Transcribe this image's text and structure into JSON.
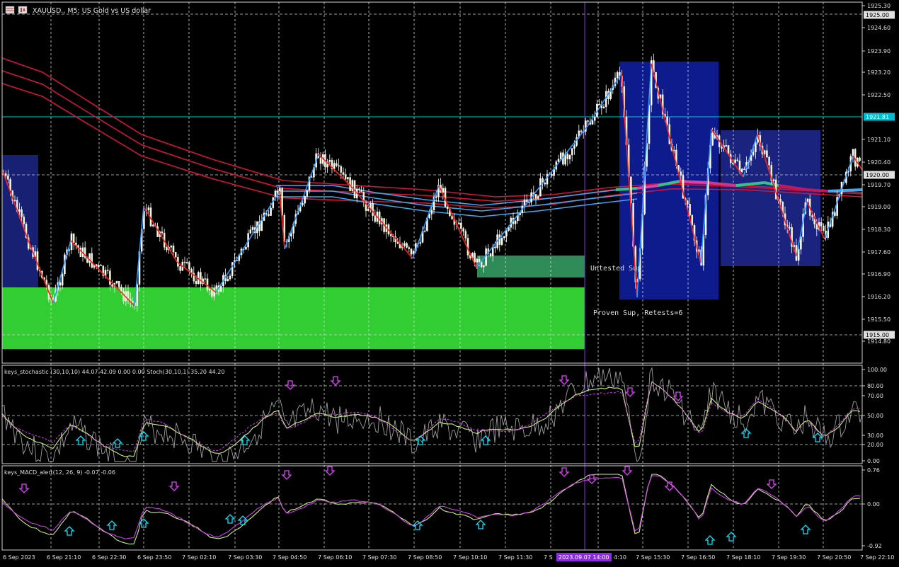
{
  "chart_header": {
    "symbol": "XAUUSD., M5: US Gold vs US dollar"
  },
  "price_axis": {
    "ticks": [
      "1925.30",
      "1924.60",
      "1923.90",
      "1923.20",
      "1922.50",
      "1921.10",
      "1920.40",
      "1919.70",
      "1919.00",
      "1918.30",
      "1917.60",
      "1916.90",
      "1916.20",
      "1915.50",
      "1914.80"
    ],
    "labels": [
      {
        "text": "1925.00",
        "kind": "level"
      },
      {
        "text": "1921.81",
        "kind": "bid"
      },
      {
        "text": "1920.00",
        "kind": "level"
      },
      {
        "text": "1915.00",
        "kind": "level"
      }
    ]
  },
  "zones": {
    "untested_label": "Untested Sup",
    "proven_label": "Proven Sup, Retests=6"
  },
  "stochastic": {
    "title": "keys_stochastic (30,10,10) 44.07 42.09 0.00 0.00 Stoch(30,10,1) 35.20 44.20",
    "ticks": [
      "100.00",
      "80.00",
      "70.00",
      "50.00",
      "30.00",
      "20.00",
      "0.00"
    ]
  },
  "macd": {
    "title": "keys_MACD_alert(12, 26, 9) -0.07 -0.06",
    "ticks": [
      "0.76",
      "0.00",
      "-0.92"
    ]
  },
  "time_axis": {
    "labels": [
      "6 Sep 2023",
      "6 Sep 21:10",
      "6 Sep 22:30",
      "6 Sep 23:50",
      "7 Sep 02:10",
      "7 Sep 03:30",
      "7 Sep 04:50",
      "7 Sep 06:10",
      "7 Sep 07:30",
      "7 Sep 08:50",
      "7 Sep 10:10",
      "7 Sep 11:30",
      "7 S",
      "4:10",
      "7 Sep 15:30",
      "7 Sep 16:50",
      "7 Sep 18:10",
      "7 Sep 19:30",
      "7 Sep 20:50",
      "7 Sep 22:10"
    ],
    "cursor_label": "2023.09.07 14:00"
  },
  "colors": {
    "background": "#000000",
    "zone_green": "#32cd32",
    "zone_dark_green": "#2e8b57",
    "box_blue": "#0c1a8a",
    "bull_candle": "#ffffff",
    "bear_candle": "#ffffff",
    "zigzag_up": "#3399ff",
    "zigzag_down": "#ff2020",
    "ma_red": "#d2143c",
    "ma_blue": "#3fa9f5",
    "cursor": "#8a2be2",
    "bid_line": "#00ced1",
    "arrow_up": "#00e5ff",
    "arrow_down": "#e040fb"
  },
  "icons": [
    "chart-menu-icon",
    "chart-type-icon"
  ]
}
